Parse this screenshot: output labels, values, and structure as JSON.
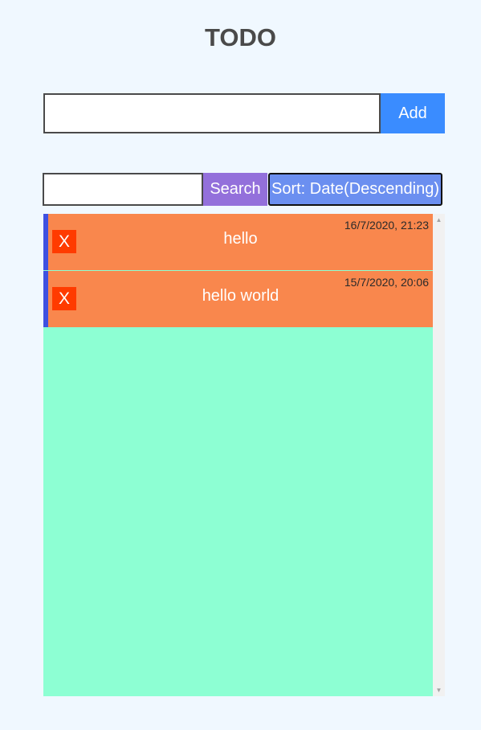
{
  "app": {
    "title": "TODO"
  },
  "add_form": {
    "input_value": "",
    "add_label": "Add"
  },
  "search_form": {
    "input_value": "",
    "search_label": "Search",
    "sort_label": "Sort: Date(Descending)"
  },
  "todos": [
    {
      "text": "hello",
      "date": "16/7/2020, 21:23",
      "delete_label": "X"
    },
    {
      "text": "hello world",
      "date": "15/7/2020, 20:06",
      "delete_label": "X"
    }
  ],
  "colors": {
    "page_background": "#f0f8ff",
    "add_button": "#3a8cff",
    "search_button": "#9370db",
    "sort_button": "#6b8ff0",
    "todo_item": "#f9874d",
    "todo_item_accent": "#3f51e0",
    "delete_button": "#ff3b00",
    "list_background": "#8dffd3"
  },
  "icons": {
    "scroll_up": "scroll-up-arrow-icon",
    "scroll_down": "scroll-down-arrow-icon"
  }
}
